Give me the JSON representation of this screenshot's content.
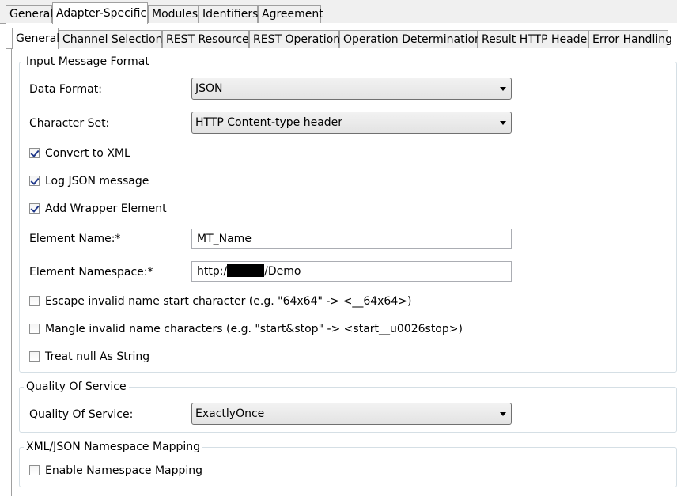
{
  "top_tabs": [
    "General",
    "Adapter-Specific",
    "Modules",
    "Identifiers",
    "Agreement"
  ],
  "sub_tabs": [
    "General",
    "Channel Selection",
    "REST Resources",
    "REST Operation",
    "Operation Determination",
    "Result HTTP Header",
    "Error Handling"
  ],
  "input_group": {
    "title": "Input Message Format",
    "data_format_label": "Data Format:",
    "data_format_value": "JSON",
    "charset_label": "Character Set:",
    "charset_value": "HTTP Content-type header",
    "convert_xml": {
      "label": "Convert to XML",
      "checked": true
    },
    "log_json": {
      "label": "Log JSON message",
      "checked": true
    },
    "add_wrapper": {
      "label": "Add Wrapper Element",
      "checked": true
    },
    "element_name_label": "Element Name:*",
    "element_name_value": "MT_Name",
    "element_ns_label": "Element Namespace:*",
    "element_ns_prefix": "http:/",
    "element_ns_suffix": "/Demo",
    "escape_invalid": {
      "label": "Escape invalid name start character (e.g. \"64x64\" -> <__64x64>)",
      "checked": false
    },
    "mangle_invalid": {
      "label": "Mangle invalid name characters (e.g. \"start&stop\" -> <start__u0026stop>)",
      "checked": false
    },
    "null_string": {
      "label": "Treat null As String",
      "checked": false
    }
  },
  "qos_group": {
    "title": "Quality Of Service",
    "qos_label": "Quality Of Service:",
    "qos_value": "ExactlyOnce"
  },
  "ns_group": {
    "title": "XML/JSON Namespace Mapping",
    "enable_mapping": {
      "label": "Enable Namespace Mapping",
      "checked": false
    }
  }
}
